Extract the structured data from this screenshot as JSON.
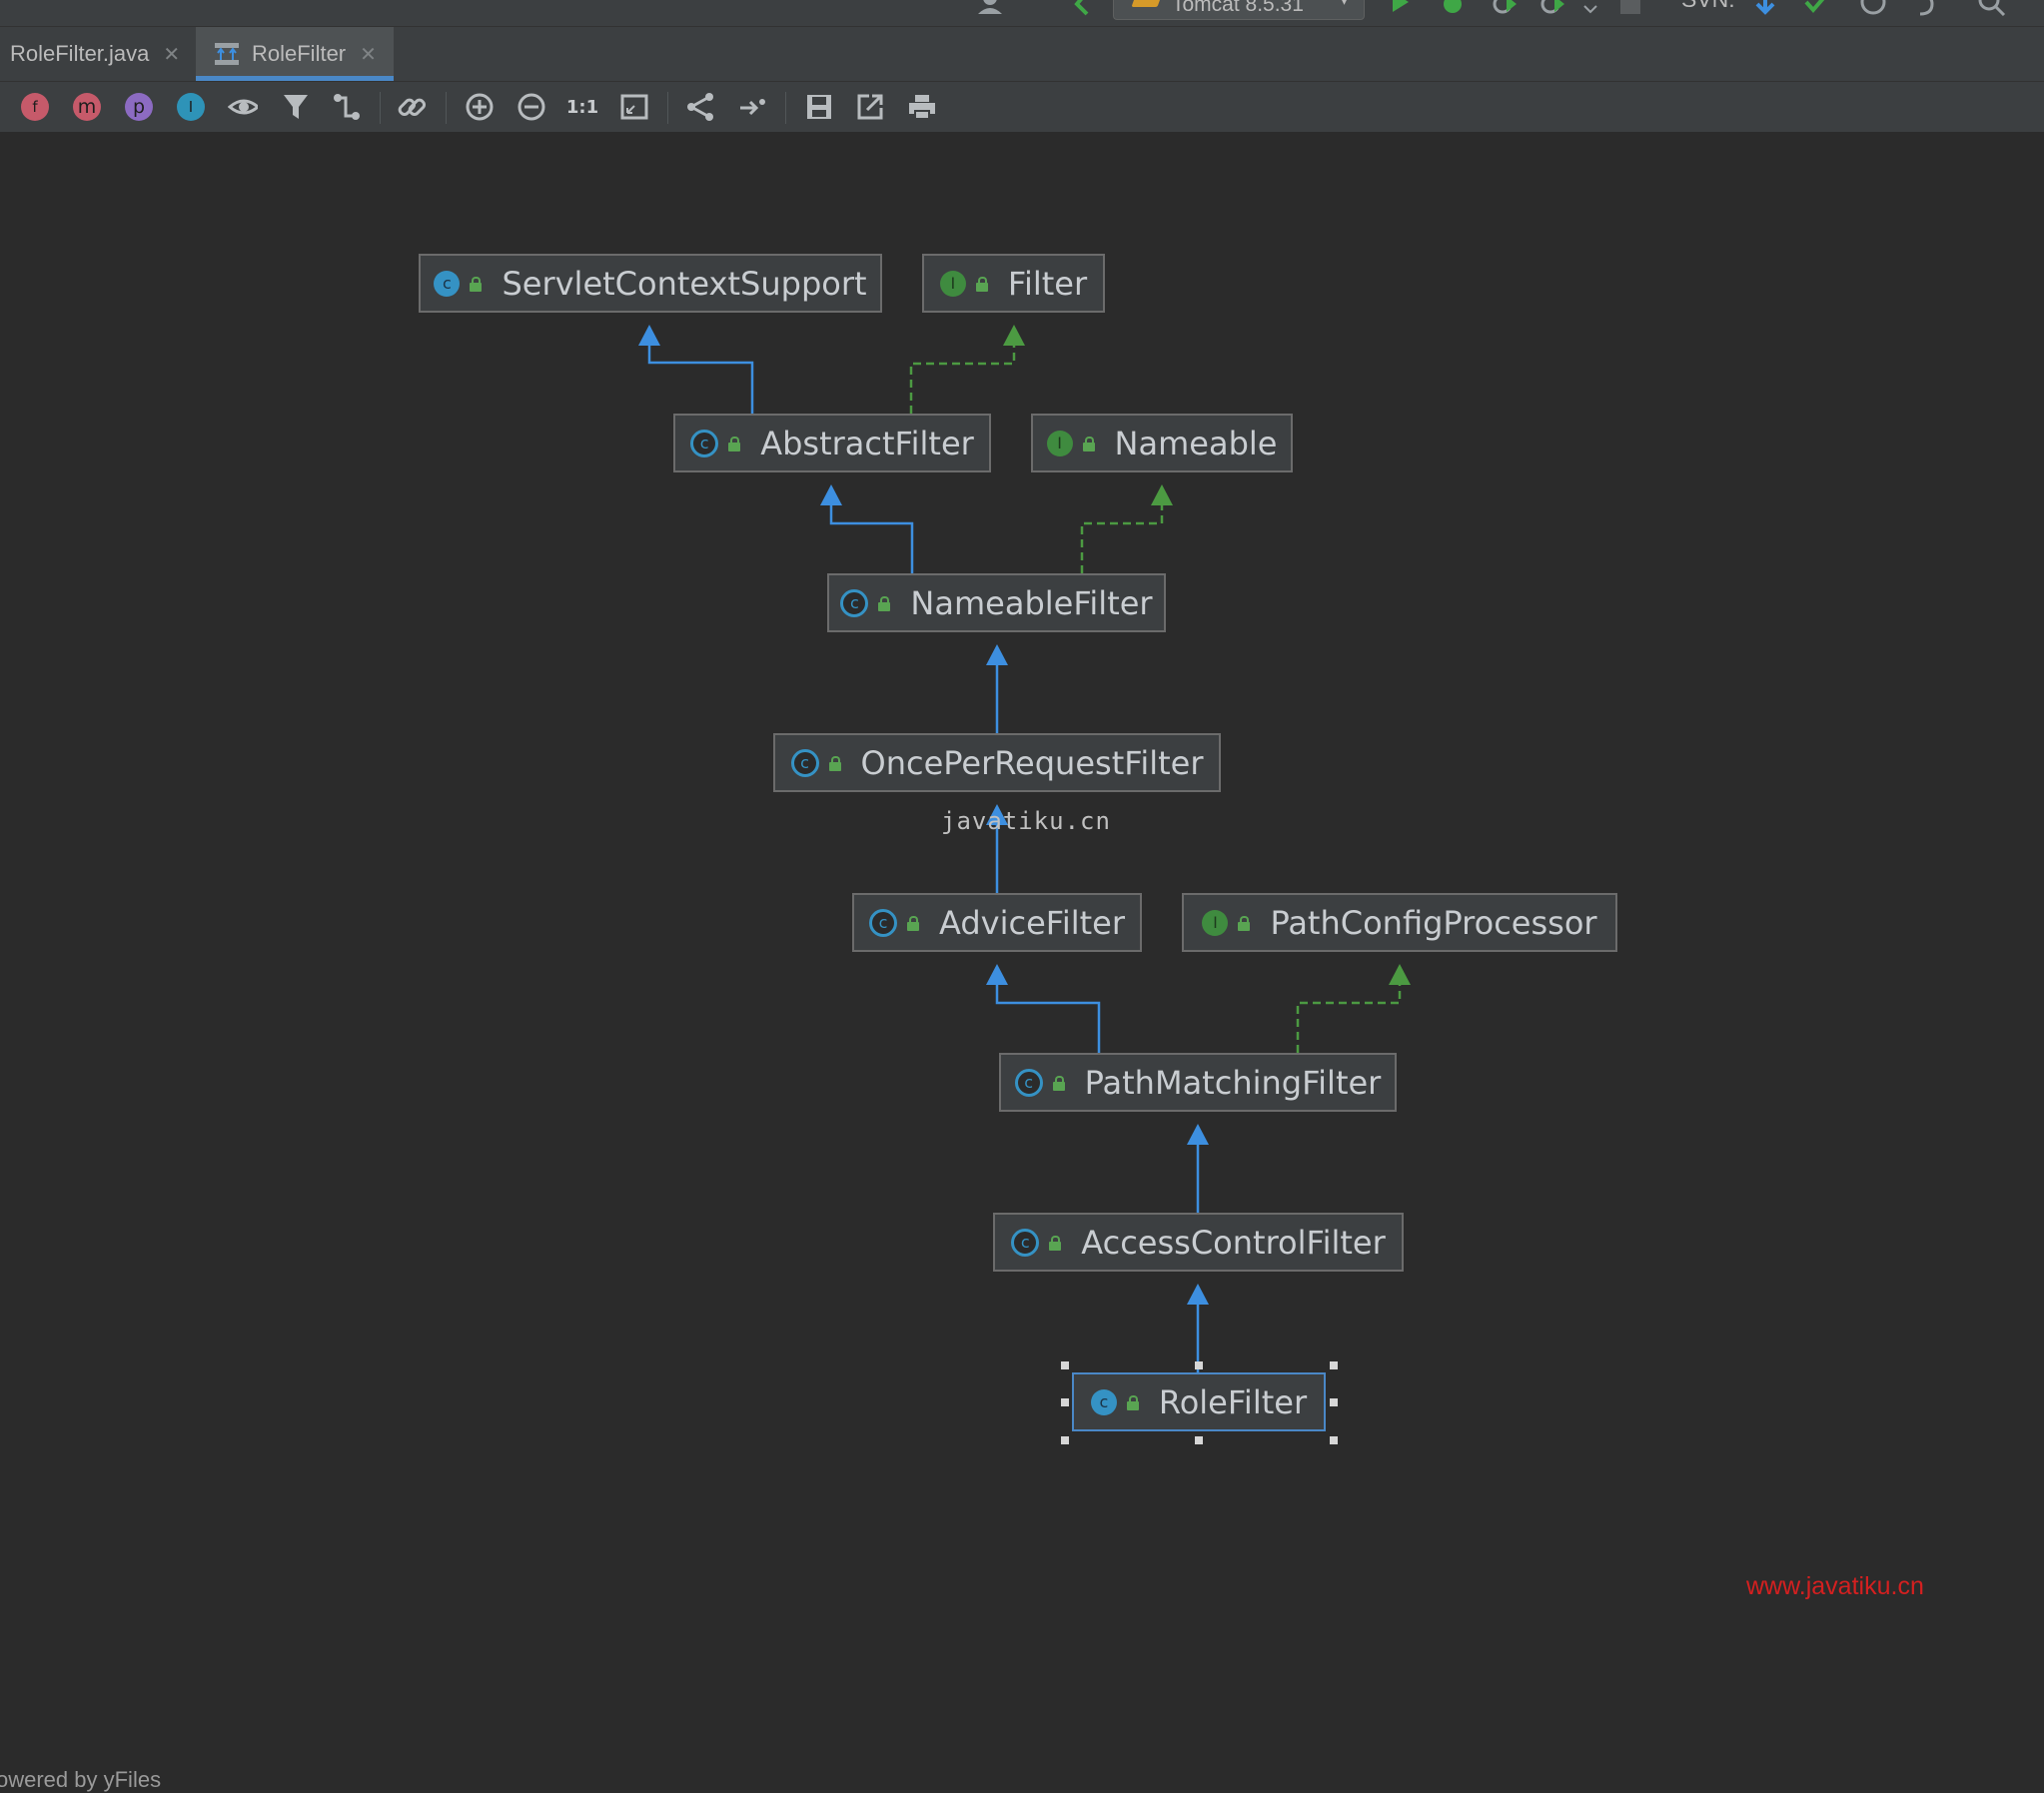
{
  "run_toolbar": {
    "run_config_label": "Tomcat 8.5.31",
    "svn_label": "SVN:"
  },
  "tabs": [
    {
      "label": "RoleFilter.java",
      "active": false
    },
    {
      "label": "RoleFilter",
      "active": true
    }
  ],
  "toolbar": {
    "icons": [
      "fields-icon",
      "methods-icon",
      "properties-icon",
      "inner-classes-icon",
      "visibility-icon",
      "filter-icon",
      "edge-routing-icon",
      "dependencies-icon",
      "zoom-in-icon",
      "zoom-out-icon",
      "actual-size-icon",
      "fit-content-icon",
      "layout-icon",
      "apply-layout-icon",
      "save-icon",
      "export-icon",
      "print-icon"
    ],
    "actual_size_label": "1:1"
  },
  "diagram": {
    "nodes": [
      {
        "id": "ServletContextSupport",
        "label": "ServletContextSupport",
        "kind": "class"
      },
      {
        "id": "Filter",
        "label": "Filter",
        "kind": "interface"
      },
      {
        "id": "AbstractFilter",
        "label": "AbstractFilter",
        "kind": "abstract"
      },
      {
        "id": "Nameable",
        "label": "Nameable",
        "kind": "interface"
      },
      {
        "id": "NameableFilter",
        "label": "NameableFilter",
        "kind": "abstract"
      },
      {
        "id": "OncePerRequestFilter",
        "label": "OncePerRequestFilter",
        "kind": "abstract"
      },
      {
        "id": "AdviceFilter",
        "label": "AdviceFilter",
        "kind": "abstract"
      },
      {
        "id": "PathConfigProcessor",
        "label": "PathConfigProcessor",
        "kind": "interface"
      },
      {
        "id": "PathMatchingFilter",
        "label": "PathMatchingFilter",
        "kind": "abstract"
      },
      {
        "id": "AccessControlFilter",
        "label": "AccessControlFilter",
        "kind": "abstract"
      },
      {
        "id": "RoleFilter",
        "label": "RoleFilter",
        "kind": "class",
        "selected": true
      }
    ],
    "edges": [
      {
        "from": "AbstractFilter",
        "to": "ServletContextSupport",
        "type": "extends"
      },
      {
        "from": "AbstractFilter",
        "to": "Filter",
        "type": "implements"
      },
      {
        "from": "NameableFilter",
        "to": "AbstractFilter",
        "type": "extends"
      },
      {
        "from": "NameableFilter",
        "to": "Nameable",
        "type": "implements"
      },
      {
        "from": "OncePerRequestFilter",
        "to": "NameableFilter",
        "type": "extends"
      },
      {
        "from": "AdviceFilter",
        "to": "OncePerRequestFilter",
        "type": "extends"
      },
      {
        "from": "PathMatchingFilter",
        "to": "AdviceFilter",
        "type": "extends"
      },
      {
        "from": "PathMatchingFilter",
        "to": "PathConfigProcessor",
        "type": "implements"
      },
      {
        "from": "AccessControlFilter",
        "to": "PathMatchingFilter",
        "type": "extends"
      },
      {
        "from": "RoleFilter",
        "to": "AccessControlFilter",
        "type": "extends"
      }
    ],
    "colors": {
      "extends": "#3d8fe0",
      "implements": "#4c9a42",
      "selected": "#4a88c7"
    }
  },
  "watermarks": {
    "center": "javatiku.cn",
    "corner": "www.javatiku.cn"
  },
  "footer": {
    "powered": "owered by yFiles"
  }
}
